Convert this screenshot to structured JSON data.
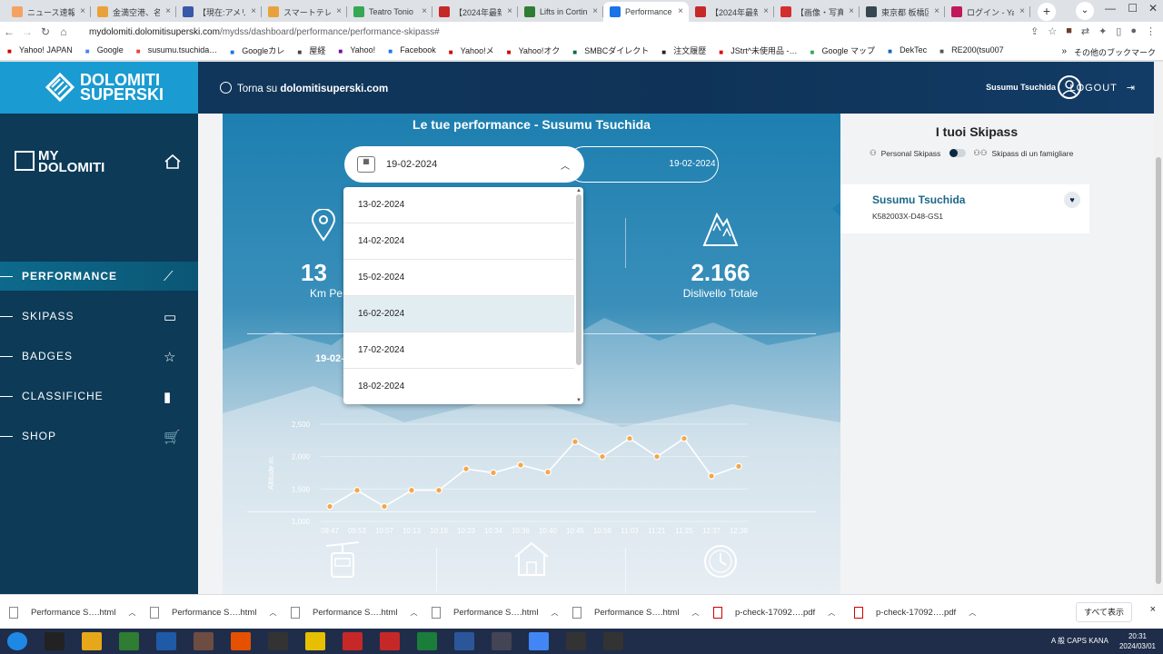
{
  "browser": {
    "tabs": [
      {
        "label": "ニュース速報",
        "fav": "#f4a261"
      },
      {
        "label": "金満空港、名鉄",
        "fav": "#e9a23b"
      },
      {
        "label": "【現在:アメリカ",
        "fav": "#3858a8"
      },
      {
        "label": "スマートテレビ",
        "fav": "#e9a23b"
      },
      {
        "label": "Teatro Tonio",
        "fav": "#34a853"
      },
      {
        "label": "【2024年最新",
        "fav": "#c62828"
      },
      {
        "label": "Lifts in Cortina",
        "fav": "#2e7d32"
      },
      {
        "label": "Performance",
        "fav": "#1a73e8",
        "active": true
      },
      {
        "label": "【2024年最新",
        "fav": "#c62828"
      },
      {
        "label": "【画像・写真",
        "fav": "#d32f2f"
      },
      {
        "label": "東京都 板橋区",
        "fav": "#37474f"
      },
      {
        "label": "ログイン - Yahoo",
        "fav": "#c2185b"
      }
    ],
    "new_tab": "+",
    "tab_close": "×",
    "url_host": "mydolomiti.dolomitisuperski.com",
    "url_path": "/mydss/dashboard/performance/performance-skipass#",
    "bookmarks": [
      "Yahoo! JAPAN",
      "Google",
      "susumu.tsuchida…",
      "Googleカレ",
      "屋経",
      "Yahoo!",
      "Facebook",
      "Yahoo!メ",
      "Yahoo!オク",
      "SMBCダイレクト",
      "注文履歴",
      "JStrt^未使用品 -…",
      "Google マップ",
      "DekTec",
      "RE200(tsu007"
    ],
    "bookmarks_more": "»",
    "other_bookmarks": "その他のブックマーク"
  },
  "header": {
    "logo_line1": "DOLOMITI",
    "logo_line2": "SUPERSKI",
    "back_prefix": "Torna su ",
    "back_site": "dolomitisuperski.com",
    "user_name": "Susumu Tsuchida",
    "logout": "LOGOUT"
  },
  "sidebar": {
    "logo_line1": "MY",
    "logo_line2": "DOLOMITI",
    "items": [
      {
        "label": "PERFORMANCE",
        "active": true
      },
      {
        "label": "SKIPASS"
      },
      {
        "label": "BADGES"
      },
      {
        "label": "CLASSIFICHE"
      },
      {
        "label": "SHOP"
      }
    ]
  },
  "main": {
    "title": "Le tue performance - Susumu Tsuchida",
    "selected_date": "19-02-2024",
    "second_date": "19-02-2024",
    "date_options": [
      "13-02-2024",
      "14-02-2024",
      "15-02-2024",
      "16-02-2024",
      "17-02-2024",
      "18-02-2024"
    ],
    "highlighted_option": "16-02-2024",
    "stat_km_value": "13",
    "stat_km_label": "Km Pe",
    "stat_dislivello_value": "2.166",
    "stat_dislivello_label": "Dislivello Totale",
    "chart_date_label": "19-02-"
  },
  "chart_data": {
    "type": "line",
    "xlabel": "Timing",
    "ylabel": "Altitude m.",
    "ylim": [
      1000,
      2500
    ],
    "y_ticks": [
      "2,500",
      "2,000",
      "1,500",
      "1,000"
    ],
    "categories": [
      "09:47",
      "09:53",
      "10:07",
      "10:13",
      "10:19",
      "10:23",
      "10:34",
      "10:36",
      "10:40",
      "10:45",
      "10:59",
      "11:03",
      "11:21",
      "11:25",
      "12:37",
      "12:39"
    ],
    "values": [
      1230,
      1480,
      1230,
      1480,
      1480,
      1810,
      1750,
      1870,
      1760,
      2230,
      2000,
      2280,
      2000,
      2280,
      1700,
      1850
    ],
    "colors": {
      "line": "#ffffff",
      "point": "#f4a64a"
    }
  },
  "right_panel": {
    "title": "I tuoi Skipass",
    "toggle_left": "Personal Skipass",
    "toggle_right": "Skipass di un famigliare",
    "card_name": "Susumu Tsuchida",
    "card_code": "K582003X-D48-GS1"
  },
  "downloads": {
    "items": [
      {
        "label": "Performance S….html",
        "pdf": false
      },
      {
        "label": "Performance S….html",
        "pdf": false
      },
      {
        "label": "Performance S….html",
        "pdf": false
      },
      {
        "label": "Performance S….html",
        "pdf": false
      },
      {
        "label": "Performance S….html",
        "pdf": false
      },
      {
        "label": "p-check-17092….pdf",
        "pdf": true
      },
      {
        "label": "p-check-17092….pdf",
        "pdf": true
      }
    ],
    "show_all": "すべて表示",
    "close": "×"
  },
  "taskbar": {
    "time": "20:31",
    "date": "2024/03/01",
    "tray": "A 般 CAPS KANA"
  }
}
